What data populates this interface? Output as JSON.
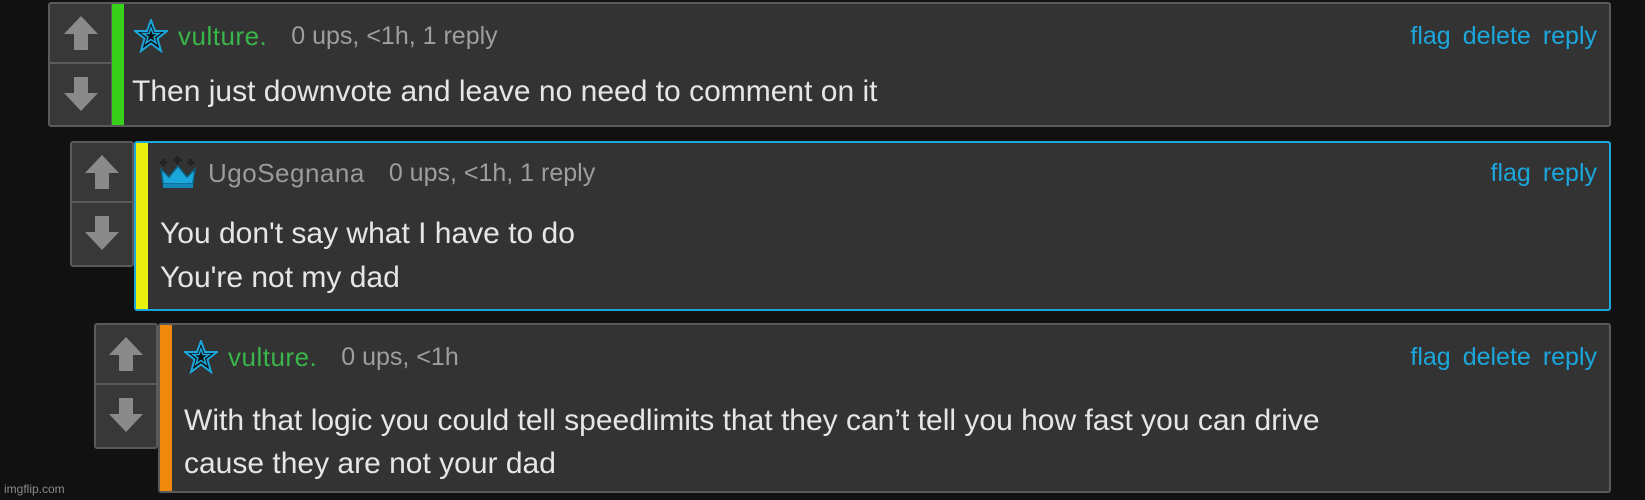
{
  "comments": [
    {
      "username": "vulture.",
      "badge": "star-badge-icon",
      "meta": "0 ups, <1h, 1 reply",
      "actions": [
        "flag",
        "delete",
        "reply"
      ],
      "lines": [
        "Then just downvote and leave no need to comment on it"
      ],
      "bar_color": "#39d01c"
    },
    {
      "username": "UgoSegnana",
      "badge": "crown-badge-icon",
      "meta": "0 ups, <1h, 1 reply",
      "actions": [
        "flag",
        "reply"
      ],
      "lines": [
        "You don't say what I have to do",
        "You're not my dad"
      ],
      "bar_color": "#e9f00d"
    },
    {
      "username": "vulture.",
      "badge": "star-badge-icon",
      "meta": "0 ups, <1h",
      "actions": [
        "flag",
        "delete",
        "reply"
      ],
      "lines": [
        "With that logic you could tell speedlimits that they can’t tell you how fast you can drive",
        "cause they are not your dad"
      ],
      "bar_color": "#f08a0f"
    }
  ],
  "watermark": "imgflip.com",
  "colors": {
    "link": "#1ba7dc",
    "username_green": "#39b54a",
    "username_grey": "#9a9a9a",
    "highlight_border": "#1ba7dc"
  }
}
